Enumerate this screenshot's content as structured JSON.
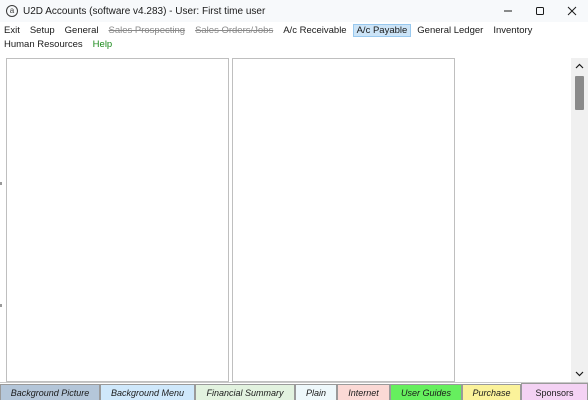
{
  "window": {
    "icon_glyph": "a",
    "title": "U2D Accounts (software v4.283) -  User: First time user"
  },
  "menu": {
    "row1": [
      {
        "label": "Exit",
        "state": "normal"
      },
      {
        "label": "Setup",
        "state": "normal"
      },
      {
        "label": "General",
        "state": "normal"
      },
      {
        "label": "Sales Prospecting",
        "state": "disabled"
      },
      {
        "label": "Sales Orders/Jobs",
        "state": "disabled"
      },
      {
        "label": "A/c Receivable",
        "state": "normal"
      },
      {
        "label": "A/c Payable",
        "state": "active"
      },
      {
        "label": "General Ledger",
        "state": "normal"
      },
      {
        "label": "Inventory",
        "state": "normal"
      }
    ],
    "row2": [
      {
        "label": "Human Resources",
        "state": "normal"
      },
      {
        "label": "Help",
        "state": "help"
      }
    ]
  },
  "tabs": [
    {
      "label": "Background Picture",
      "color": "#b4c6d9"
    },
    {
      "label": "Background Menu",
      "color": "#cfe8fb"
    },
    {
      "label": "Financial Summary",
      "color": "#e2f2df"
    },
    {
      "label": "Plain",
      "color": "#eef8fb"
    },
    {
      "label": "Internet",
      "color": "#fbd9d5"
    },
    {
      "label": "User Guides",
      "color": "#66ef5e"
    },
    {
      "label": "Purchase",
      "color": "#fbf29a"
    },
    {
      "label": "Sponsors",
      "color": "#f4d2f4"
    }
  ],
  "icons": {
    "minimize": "minimize-icon",
    "maximize": "maximize-icon",
    "close": "close-icon",
    "scroll_up": "chevron-up-icon",
    "scroll_down": "chevron-down-icon"
  }
}
